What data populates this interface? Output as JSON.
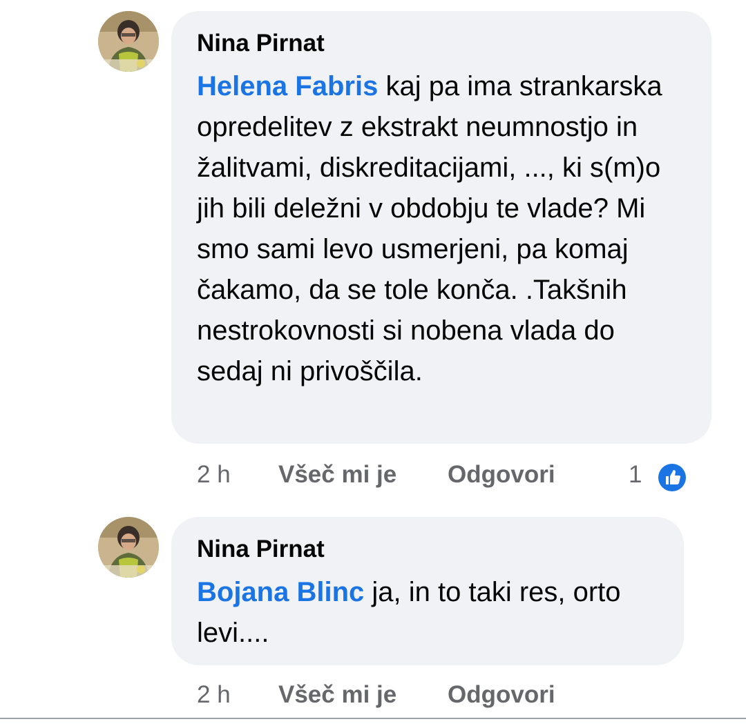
{
  "comments": [
    {
      "author": "Nina Pirnat",
      "mention": "Helena Fabris",
      "text": " kaj pa ima strankarska opredelitev z ekstrakt neumnostjo in žalitvami, diskreditacijami, ..., ki s(m)o jih bili deležni v obdobju te vlade? Mi smo sami levo usmerjeni, pa komaj čakamo, da se tole konča. .Takšnih nestrokovnosti si nobena vlada do sedaj ni privoščila.",
      "time": "2 h",
      "like_label": "Všeč mi je",
      "reply_label": "Odgovori",
      "reaction_count": "1",
      "reaction_icon": "thumbs-up-icon",
      "reaction_color": "#1b74e4"
    },
    {
      "author": "Nina Pirnat",
      "mention": "Bojana Blinc",
      "text": " ja, in to taki res, orto levi....",
      "time": "2 h",
      "like_label": "Všeč mi je",
      "reply_label": "Odgovori"
    }
  ],
  "colors": {
    "bubble_bg": "#f0f2f5",
    "mention": "#1b74e4",
    "meta_text": "#65676b"
  }
}
